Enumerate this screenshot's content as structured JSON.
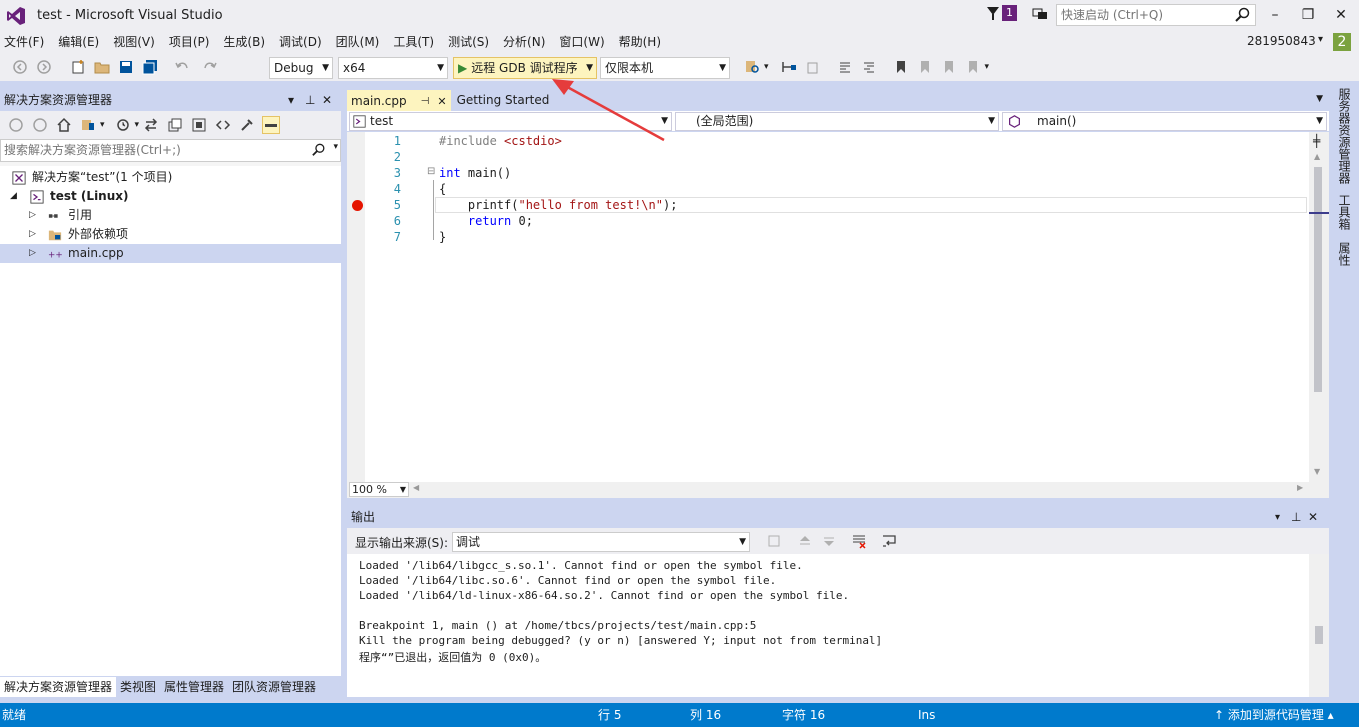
{
  "window": {
    "title": "test - Microsoft Visual Studio",
    "notification_count": "1",
    "quick_launch_placeholder": "快速启动 (Ctrl+Q)",
    "minimize": "–",
    "maximize": "❐",
    "close": "✕"
  },
  "menu": [
    "文件(F)",
    "编辑(E)",
    "视图(V)",
    "项目(P)",
    "生成(B)",
    "调试(D)",
    "团队(M)",
    "工具(T)",
    "测试(S)",
    "分析(N)",
    "窗口(W)",
    "帮助(H)"
  ],
  "account": {
    "name": "281950843",
    "badge": "2"
  },
  "toolbar": {
    "config": "Debug",
    "platform": "x64",
    "run_label": "远程 GDB 调试程序",
    "target": "仅限本机"
  },
  "solution_explorer": {
    "title": "解决方案资源管理器",
    "search_placeholder": "搜索解决方案资源管理器(Ctrl+;)",
    "tree": [
      {
        "label": "解决方案“test”(1 个项目)",
        "indent": 0
      },
      {
        "label": "test (Linux)",
        "indent": 1
      },
      {
        "label": "引用",
        "indent": 2
      },
      {
        "label": "外部依赖项",
        "indent": 2
      },
      {
        "label": "main.cpp",
        "indent": 2
      }
    ],
    "bottom_tabs": [
      "解决方案资源管理器",
      "类视图",
      "属性管理器",
      "团队资源管理器"
    ]
  },
  "editor": {
    "tabs": [
      "main.cpp",
      "Getting Started"
    ],
    "nav": {
      "project": "test",
      "scope": "(全局范围)",
      "member": "main()"
    },
    "lines": [
      "1",
      "2",
      "3",
      "4",
      "5",
      "6",
      "7"
    ],
    "code": {
      "l1_pp": "#include ",
      "l1_str": "<cstdio>",
      "l3_kw": "int",
      "l3_rest": " main()",
      "l4": "{",
      "l5_a": "    printf(",
      "l5_str": "\"hello from test!\\n\"",
      "l5_b": ");",
      "l6_kw": "    return",
      "l6_rest": " 0;",
      "l7": "}"
    },
    "zoom": "100 %"
  },
  "output": {
    "title": "输出",
    "source_label": "显示输出来源(S):",
    "source_value": "调试",
    "lines": [
      "Loaded '/lib64/libgcc_s.so.1'. Cannot find or open the symbol file.",
      "Loaded '/lib64/libc.so.6'. Cannot find or open the symbol file.",
      "Loaded '/lib64/ld-linux-x86-64.so.2'. Cannot find or open the symbol file.",
      "",
      "Breakpoint 1, main () at /home/tbcs/projects/test/main.cpp:5",
      "Kill the program being debugged? (y or n) [answered Y; input not from terminal]",
      "程序“”已退出，返回值为 0 (0x0)。"
    ]
  },
  "right_tabs": [
    "服务器资源管理器",
    "工具箱",
    "属性"
  ],
  "status": {
    "ready": "就绪",
    "line": "行 5",
    "col": "列 16",
    "char": "字符 16",
    "mode": "Ins",
    "source_control": "↑ 添加到源代码管理 ▴"
  },
  "colors": {
    "accent": "#007acc",
    "vs_purple": "#68217a",
    "breakpoint": "#e51400",
    "run_button": "#fdf4bf",
    "annotation_arrow": "#e53c3c"
  }
}
